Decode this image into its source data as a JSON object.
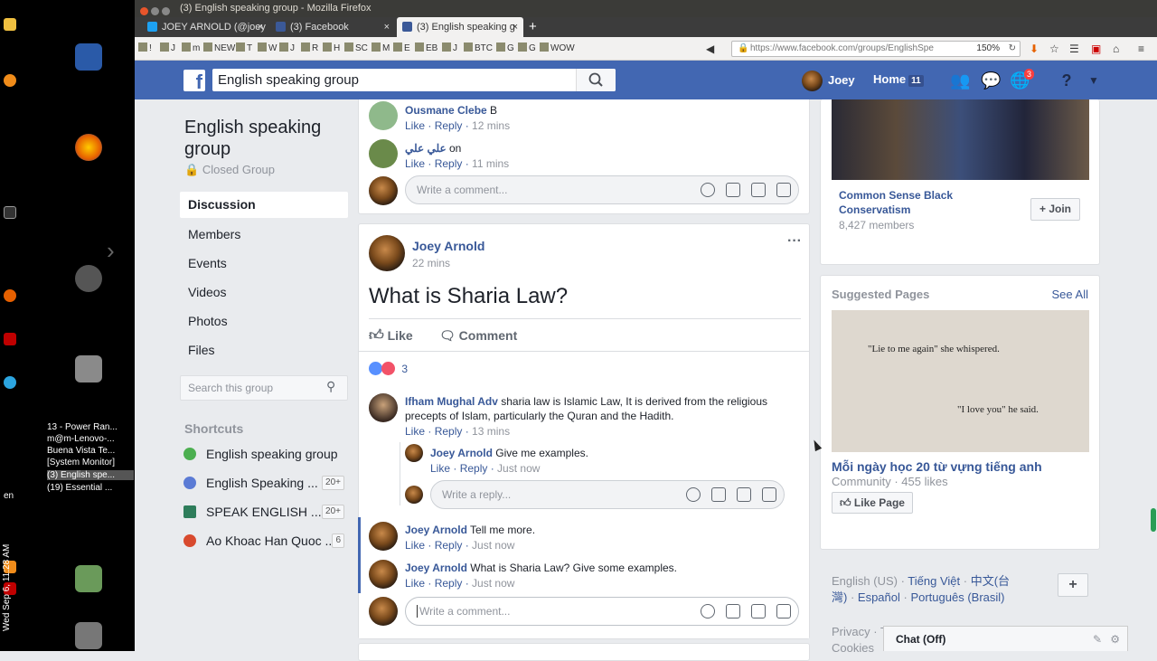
{
  "window": {
    "title": "(3) English speaking group - Mozilla Firefox"
  },
  "taskbar": {
    "windows": [
      "13 - Power Ran...",
      "m@m-Lenovo-...",
      "Buena Vista Te...",
      "[System Monitor]",
      "(3) English spe...",
      "(19) Essential ..."
    ],
    "lang": "en",
    "datetime": "Wed Sep 6, 11:28 AM"
  },
  "tabs": [
    {
      "label": "JOEY ARNOLD (@joey",
      "close": "×"
    },
    {
      "label": "(3) Facebook",
      "close": "×"
    },
    {
      "label": "(3) English speaking g",
      "close": "×"
    }
  ],
  "newtab": "+",
  "bookmarks": [
    "!",
    "J",
    "m",
    "NEW",
    "T",
    "W",
    "J",
    "R",
    "H",
    "SC",
    "M",
    "E",
    "EB",
    "J",
    "BTC",
    "G",
    "G",
    "WOW"
  ],
  "url": "https://www.facebook.com/groups/EnglishSpe",
  "zoom": "150%",
  "fb": {
    "search_value": "English speaking group",
    "user": "Joey",
    "home": "Home",
    "home_count": "11",
    "notif_count": "3"
  },
  "group": {
    "name": "English speaking group",
    "type": "Closed Group",
    "nav": [
      "Discussion",
      "Members",
      "Events",
      "Videos",
      "Photos",
      "Files"
    ],
    "search_placeholder": "Search this group",
    "shortcuts_title": "Shortcuts",
    "shortcuts": [
      {
        "label": "English speaking group",
        "count": "",
        "color": "#4caf50"
      },
      {
        "label": "English Speaking ...",
        "count": "20+",
        "color": "#5b7bd5"
      },
      {
        "label": "SPEAK ENGLISH ...",
        "count": "20+",
        "color": "#2e7d5b"
      },
      {
        "label": "Ao Khoac Han Quoc ...",
        "count": "6",
        "color": "#d84a2e"
      }
    ]
  },
  "top_comments": [
    {
      "name": "Ousmane Clebe",
      "text": "B",
      "like": "Like",
      "reply": "Reply",
      "time": "12 mins"
    },
    {
      "name": "علي علي",
      "text": "on",
      "like": "Like",
      "reply": "Reply",
      "time": "11 mins"
    }
  ],
  "write_comment": "Write a comment...",
  "write_reply": "Write a reply...",
  "post": {
    "author": "Joey Arnold",
    "time": "22 mins",
    "menu": "···",
    "text": "What is Sharia Law?",
    "like_label": "Like",
    "comment_label": "Comment",
    "reaction_count": "3",
    "comments": [
      {
        "name": "Ifham Mughal Adv",
        "text": "sharia law is Islamic Law, It is derived from the religious precepts of Islam, particularly the Quran and the Hadith.",
        "like": "Like",
        "reply": "Reply",
        "time": "13 mins"
      },
      {
        "name": "Joey Arnold",
        "text": "Give me examples.",
        "like": "Like",
        "reply": "Reply",
        "time": "Just now"
      },
      {
        "name": "Joey Arnold",
        "text": "Tell me more.",
        "like": "Like",
        "reply": "Reply",
        "time": "Just now"
      },
      {
        "name": "Joey Arnold",
        "text": "What is Sharia Law? Give some examples.",
        "like": "Like",
        "reply": "Reply",
        "time": "Just now"
      }
    ]
  },
  "right": {
    "group_card": {
      "name": "Common Sense Black Conservatism",
      "members": "8,427 members",
      "join": "Join"
    },
    "suggested_title": "Suggested Pages",
    "see_all": "See All",
    "image_quote1": "\"Lie to me again\" she whispered.",
    "image_quote2": "\"I love you\" he said.",
    "page_name": "Mỗi ngày học 20 từ vựng tiếng anh",
    "page_meta": "Community · 455 likes",
    "like_page": "Like Page",
    "languages": [
      "English (US)",
      "Tiếng Việt",
      "中文(台灣)",
      "Español",
      "Português (Brasil)"
    ],
    "lang_plus": "+",
    "footer": [
      "Privacy",
      "T",
      "Cookies"
    ]
  },
  "chat": {
    "label": "Chat (Off)"
  }
}
